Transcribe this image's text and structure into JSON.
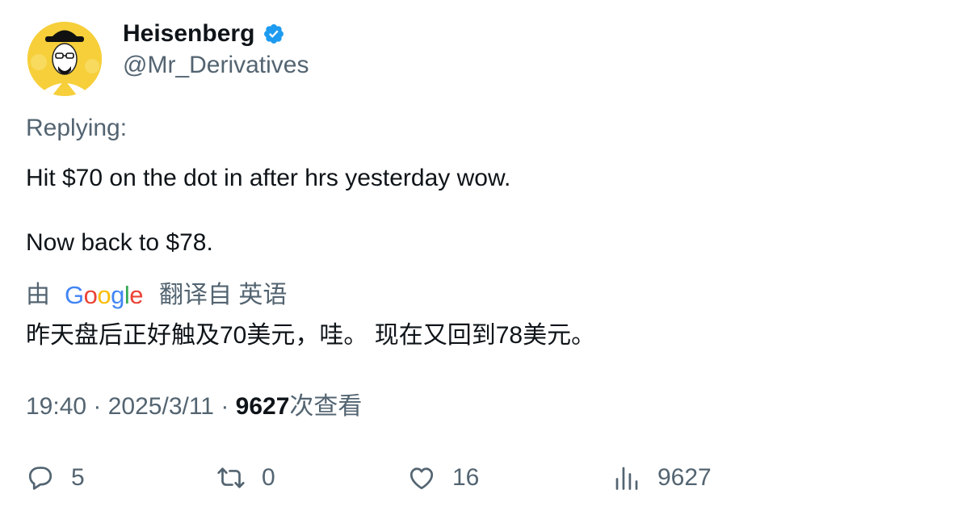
{
  "author": {
    "display_name": "Heisenberg",
    "handle": "@Mr_Derivatives",
    "verified_icon": "verified-badge-icon"
  },
  "tweet": {
    "replying_label": "Replying:",
    "text_line1": "Hit $70 on the dot in after hrs yesterday wow.",
    "text_line2": "Now back to $78."
  },
  "translation": {
    "by_label": "由",
    "provider_logo": "Google",
    "from_label": "翻译自 英语",
    "translated_text": "昨天盘后正好触及70美元，哇。 现在又回到78美元。"
  },
  "meta": {
    "time": "19:40",
    "separator": "·",
    "date": "2025/3/11",
    "views_count": "9627",
    "views_label": "次查看"
  },
  "actions": {
    "reply_count": "5",
    "retweet_count": "0",
    "like_count": "16",
    "views_count": "9627"
  },
  "colors": {
    "primary_text": "#0f1419",
    "secondary_text": "#536471",
    "verified_blue": "#1d9bf0",
    "avatar_yellow": "#f6cf3a"
  }
}
